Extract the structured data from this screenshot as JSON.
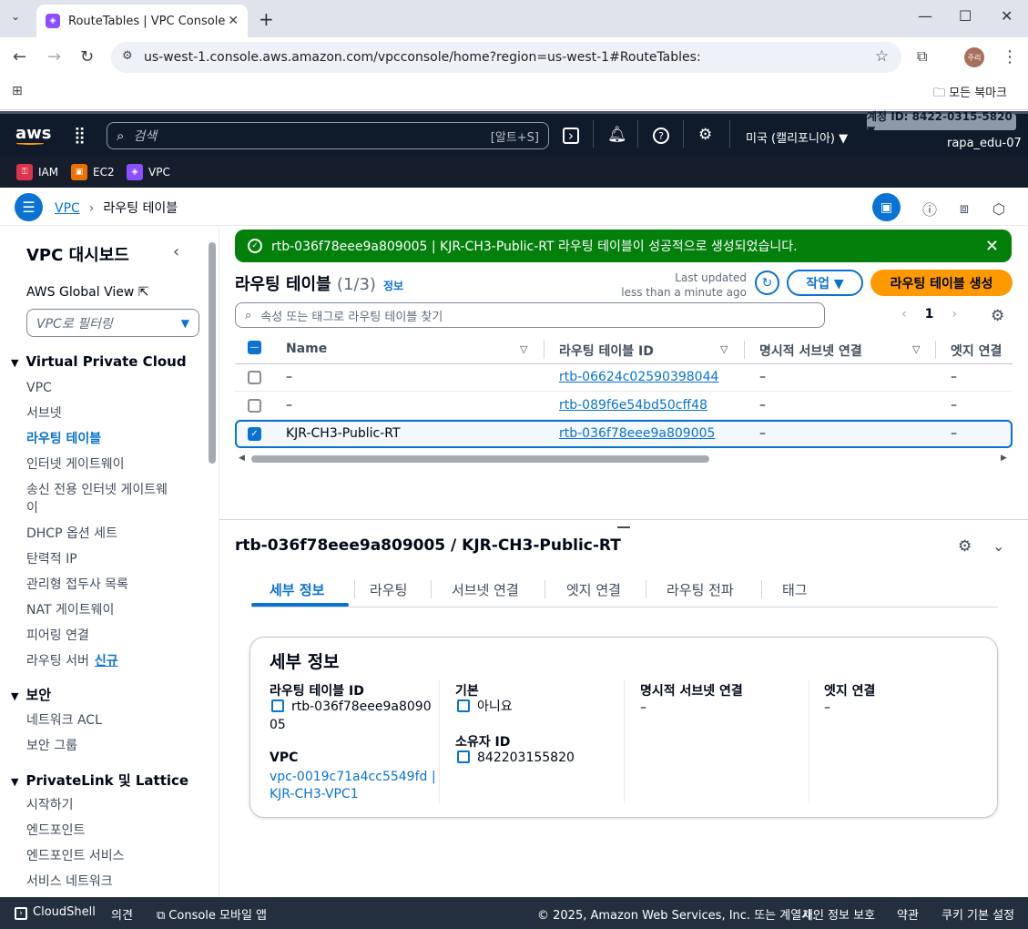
{
  "browser": {
    "tab_title": "RouteTables | VPC Console",
    "url": "us-west-1.console.aws.amazon.com/vpcconsole/home?region=us-west-1#RouteTables:",
    "bookmarks_label": "모든 북마크",
    "profile": "주리"
  },
  "aws_nav": {
    "logo": "aws",
    "search_placeholder": "검색",
    "search_shortcut": "[알트+S]",
    "region": "미국 (캘리포니아) ▼",
    "account": "계정 ID: 8422-0315-5820 ▼",
    "user": "rapa_edu-07",
    "favorites": [
      {
        "label": "IAM",
        "color": "#dd344c"
      },
      {
        "label": "EC2",
        "color": "#ed7100"
      },
      {
        "label": "VPC",
        "color": "#8c4fff"
      }
    ]
  },
  "breadcrumb": {
    "root": "VPC",
    "current": "라우팅 테이블"
  },
  "sidebar": {
    "title": "VPC 대시보드",
    "global_view": "AWS Global View",
    "filter_placeholder": "VPC로 필터링",
    "sections": [
      {
        "title": "Virtual Private Cloud",
        "items": [
          "VPC",
          "서브넷",
          "라우팅 테이블",
          "인터넷 게이트웨이",
          "송신 전용 인터넷 게이트웨",
          "이",
          "DHCP 옵션 세트",
          "탄력적 IP",
          "관리형 접두사 목록",
          "NAT 게이트웨이",
          "피어링 연결",
          "라우팅 서버"
        ]
      },
      {
        "title": "보안",
        "items": [
          "네트워크 ACL",
          "보안 그룹"
        ]
      },
      {
        "title": "PrivateLink 및 Lattice",
        "items": [
          "시작하기",
          "엔드포인트",
          "엔드포인트 서비스",
          "서비스 네트워크"
        ]
      }
    ],
    "new_badge": "신규"
  },
  "flash": {
    "message": "rtb-036f78eee9a809005 | KJR-CH3-Public-RT 라우팅 테이블이 성공적으로 생성되었습니다.",
    "color": "#037f0c"
  },
  "header": {
    "title": "라우팅 테이블",
    "count": "(1/3)",
    "info": "정보",
    "last_updated_1": "Last updated",
    "last_updated_2": "less than a minute ago",
    "actions": "작업 ▼",
    "create": "라우팅 테이블 생성",
    "search_placeholder": "속성 또는 태그로 라우팅 테이블 찾기",
    "page": "1"
  },
  "table": {
    "columns": [
      "Name",
      "라우팅 테이블 ID",
      "명시적 서브넷 연결",
      "엣지 연결"
    ],
    "rows": [
      {
        "name": "–",
        "id": "rtb-06624c02590398044",
        "subnet": "–",
        "edge": "–",
        "selected": false
      },
      {
        "name": "–",
        "id": "rtb-089f6e54bd50cff48",
        "subnet": "–",
        "edge": "–",
        "selected": false
      },
      {
        "name": "KJR-CH3-Public-RT",
        "id": "rtb-036f78eee9a809005",
        "subnet": "–",
        "edge": "–",
        "selected": true
      }
    ]
  },
  "detail": {
    "title": "rtb-036f78eee9a809005 / KJR-CH3-Public-RT",
    "tabs": [
      "세부 정보",
      "라우팅",
      "서브넷 연결",
      "엣지 연결",
      "라우팅 전파",
      "태그"
    ],
    "card_title": "세부 정보",
    "fields": {
      "rt_id_label": "라우팅 테이블 ID",
      "rt_id_1": "rtb-036f78eee9a8090",
      "rt_id_2": "05",
      "vpc_label": "VPC",
      "vpc_1": "vpc-0019c71a4cc5549fd |",
      "vpc_2": "KJR-CH3-VPC1",
      "default_label": "기본",
      "default_value": "아니요",
      "owner_label": "소유자 ID",
      "owner_value": "842203155820",
      "subnet_label": "명시적 서브넷 연결",
      "subnet_value": "–",
      "edge_label": "엣지 연결",
      "edge_value": "–"
    }
  },
  "footer": {
    "cloudshell": "CloudShell",
    "feedback": "의견",
    "mobile": "Console 모바일 앱",
    "copyright": "© 2025, Amazon Web Services, Inc. 또는 계열사.",
    "privacy": "개인 정보 보호",
    "terms": "약관",
    "cookies": "쿠키 기본 설정"
  }
}
